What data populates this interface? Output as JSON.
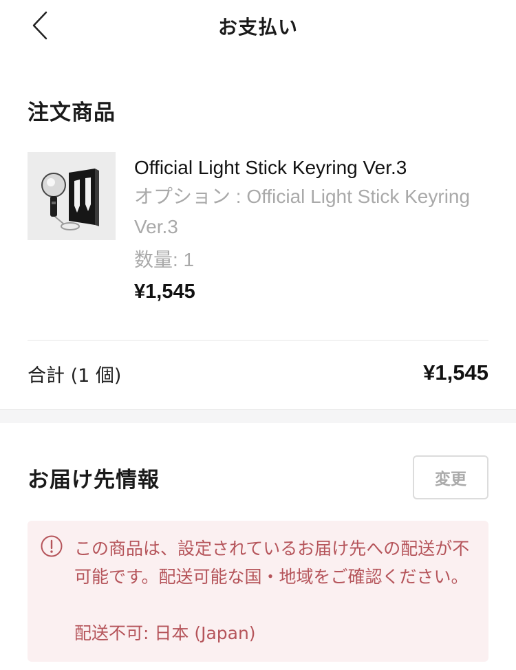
{
  "header": {
    "title": "お支払い",
    "back_icon": "chevron-left-icon"
  },
  "order": {
    "section_title": "注文商品",
    "product": {
      "name": "Official Light Stick Keyring Ver.3",
      "option": "オプション : Official Light Stick Keyring Ver.3",
      "quantity": "数量: 1",
      "price": "¥1,545"
    },
    "total_label": "合計 (1 個)",
    "total_value": "¥1,545"
  },
  "address": {
    "section_title": "お届け先情報",
    "change_label": "変更",
    "alert": {
      "icon": "exclamation-circle-icon",
      "message": "この商品は、設定されているお届け先への配送が不可能です。配送可能な国・地域をご確認ください。",
      "detail": "配送不可: 日本 (Japan)",
      "color": "#b5545a",
      "background": "#fbf0f1"
    }
  }
}
